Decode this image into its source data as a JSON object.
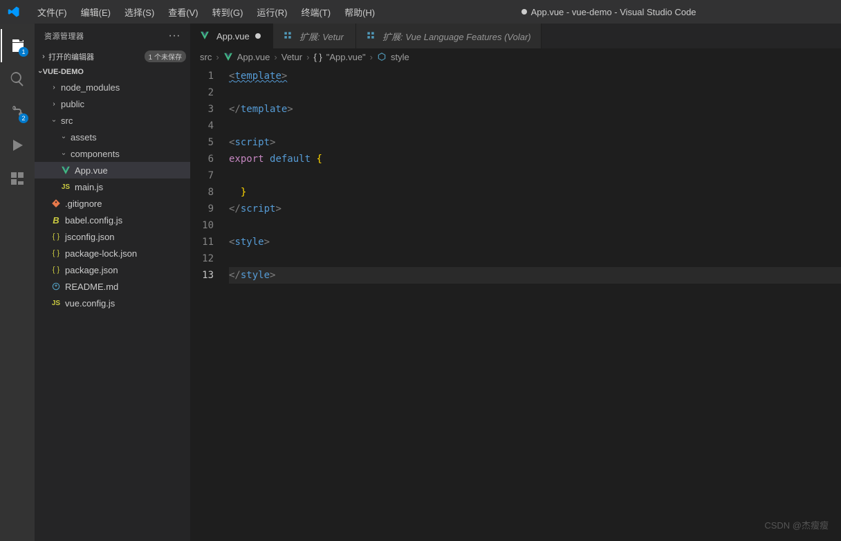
{
  "title": {
    "dirty": true,
    "text": "App.vue - vue-demo - Visual Studio Code"
  },
  "menu": [
    "文件(F)",
    "编辑(E)",
    "选择(S)",
    "查看(V)",
    "转到(G)",
    "运行(R)",
    "终端(T)",
    "帮助(H)"
  ],
  "activity": {
    "explorer_badge": "1",
    "scm_badge": "2"
  },
  "sidebar": {
    "title": "资源管理器",
    "open_editors": {
      "label": "打开的编辑器",
      "badge": "1 个未保存"
    },
    "project": "VUE-DEMO",
    "tree": [
      {
        "depth": 1,
        "type": "folder",
        "open": false,
        "name": "node_modules"
      },
      {
        "depth": 1,
        "type": "folder",
        "open": false,
        "name": "public"
      },
      {
        "depth": 1,
        "type": "folder",
        "open": true,
        "name": "src"
      },
      {
        "depth": 2,
        "type": "folder",
        "open": true,
        "name": "assets"
      },
      {
        "depth": 2,
        "type": "folder",
        "open": true,
        "name": "components"
      },
      {
        "depth": 2,
        "type": "file",
        "icon": "vue",
        "name": "App.vue",
        "selected": true
      },
      {
        "depth": 2,
        "type": "file",
        "icon": "js",
        "name": "main.js"
      },
      {
        "depth": 1,
        "type": "file",
        "icon": "git",
        "name": ".gitignore"
      },
      {
        "depth": 1,
        "type": "file",
        "icon": "babel",
        "name": "babel.config.js"
      },
      {
        "depth": 1,
        "type": "file",
        "icon": "json",
        "name": "jsconfig.json"
      },
      {
        "depth": 1,
        "type": "file",
        "icon": "json",
        "name": "package-lock.json"
      },
      {
        "depth": 1,
        "type": "file",
        "icon": "json",
        "name": "package.json"
      },
      {
        "depth": 1,
        "type": "file",
        "icon": "md",
        "name": "README.md"
      },
      {
        "depth": 1,
        "type": "file",
        "icon": "js",
        "name": "vue.config.js"
      }
    ]
  },
  "tabs": [
    {
      "icon": "vue",
      "label": "App.vue",
      "active": true,
      "dirty": true,
      "italic": false
    },
    {
      "icon": "ext",
      "label": "扩展: Vetur",
      "active": false,
      "dirty": false,
      "italic": true
    },
    {
      "icon": "ext",
      "label": "扩展: Vue Language Features (Volar)",
      "active": false,
      "dirty": false,
      "italic": true
    }
  ],
  "breadcrumb": {
    "parts": [
      "src",
      "App.vue",
      "Vetur",
      "\"App.vue\"",
      "style"
    ]
  },
  "editor": {
    "lines": [
      {
        "n": 1,
        "tokens": [
          [
            "bracket",
            "<"
          ],
          [
            "tag",
            "template"
          ],
          [
            "bracket",
            ">"
          ]
        ],
        "squiggle": true
      },
      {
        "n": 2,
        "tokens": []
      },
      {
        "n": 3,
        "tokens": [
          [
            "bracket",
            "</"
          ],
          [
            "tag",
            "template"
          ],
          [
            "bracket",
            ">"
          ]
        ]
      },
      {
        "n": 4,
        "tokens": []
      },
      {
        "n": 5,
        "tokens": [
          [
            "bracket",
            "<"
          ],
          [
            "tag",
            "script"
          ],
          [
            "bracket",
            ">"
          ]
        ]
      },
      {
        "n": 6,
        "tokens": [
          [
            "keyword",
            "export"
          ],
          [
            "text",
            " "
          ],
          [
            "default",
            "default"
          ],
          [
            "text",
            " "
          ],
          [
            "brace",
            "{"
          ]
        ]
      },
      {
        "n": 7,
        "tokens": []
      },
      {
        "n": 8,
        "tokens": [
          [
            "text",
            "  "
          ],
          [
            "brace",
            "}"
          ]
        ]
      },
      {
        "n": 9,
        "tokens": [
          [
            "bracket",
            "</"
          ],
          [
            "tag",
            "script"
          ],
          [
            "bracket",
            ">"
          ]
        ]
      },
      {
        "n": 10,
        "tokens": []
      },
      {
        "n": 11,
        "tokens": [
          [
            "bracket",
            "<"
          ],
          [
            "tag",
            "style"
          ],
          [
            "bracket",
            ">"
          ]
        ]
      },
      {
        "n": 12,
        "tokens": []
      },
      {
        "n": 13,
        "tokens": [
          [
            "bracket",
            "</"
          ],
          [
            "tag",
            "style"
          ],
          [
            "bracket",
            ">"
          ]
        ],
        "current": true
      }
    ]
  },
  "watermark": "CSDN @杰瘦瘦"
}
